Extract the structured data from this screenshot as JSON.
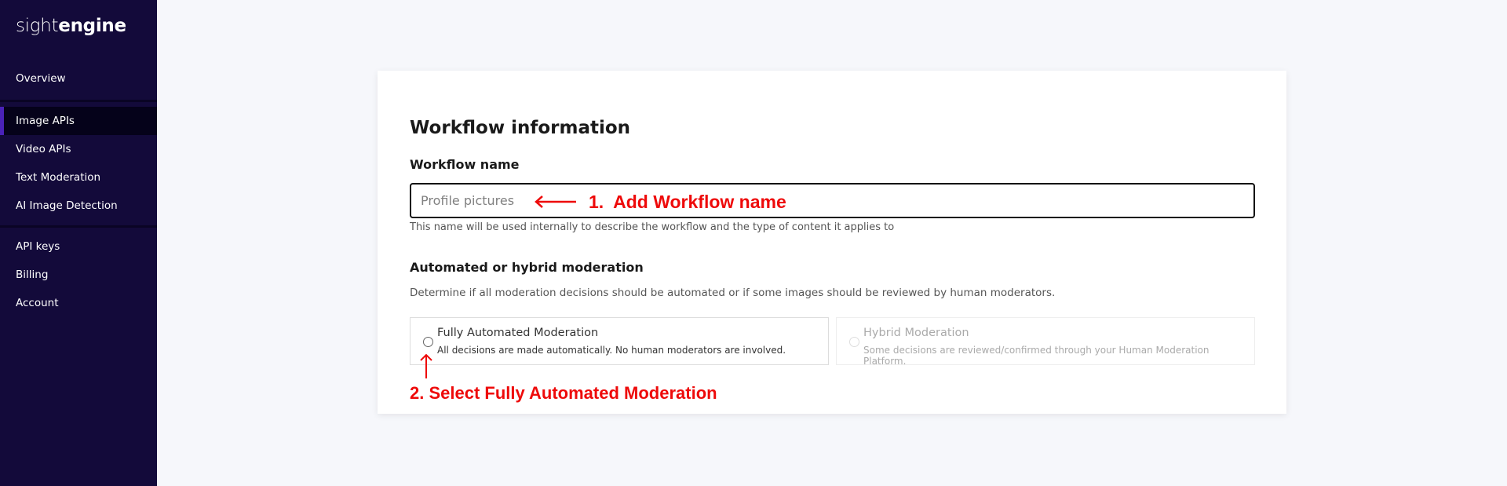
{
  "sidebar": {
    "logo": {
      "light": "sight",
      "bold": "engine"
    },
    "items": [
      {
        "label": "Overview",
        "active": false
      },
      {
        "label": "Image APIs",
        "active": true
      },
      {
        "label": "Video APIs",
        "active": false
      },
      {
        "label": "Text Moderation",
        "active": false
      },
      {
        "label": "AI Image Detection",
        "active": false
      },
      {
        "label": "API keys",
        "active": false
      },
      {
        "label": "Billing",
        "active": false
      },
      {
        "label": "Account",
        "active": false
      }
    ]
  },
  "form": {
    "title": "Workflow information",
    "name_label": "Workflow name",
    "name_placeholder": "Profile pictures",
    "name_value": "",
    "name_help": "This name will be used internally to describe the workflow and the type of content it applies to",
    "moderation_title": "Automated or hybrid moderation",
    "moderation_desc": "Determine if all moderation decisions should be automated or if some images should be reviewed by human moderators.",
    "options": [
      {
        "title": "Fully Automated Moderation",
        "desc": "All decisions are made automatically. No human moderators are involved.",
        "selected": false,
        "disabled": false
      },
      {
        "title": "Hybrid Moderation",
        "desc": "Some decisions are reviewed/confirmed through your Human Moderation Platform.",
        "selected": false,
        "disabled": true
      }
    ]
  },
  "annotations": {
    "step1": "1.  Add Workflow name",
    "step2": "2. Select Fully Automated Moderation",
    "color": "#ee0a0a"
  },
  "colors": {
    "sidebar_bg": "#130a3a",
    "sidebar_active_bg": "#05021a",
    "accent": "#4a22b8",
    "page_bg": "#f6f7fb"
  }
}
